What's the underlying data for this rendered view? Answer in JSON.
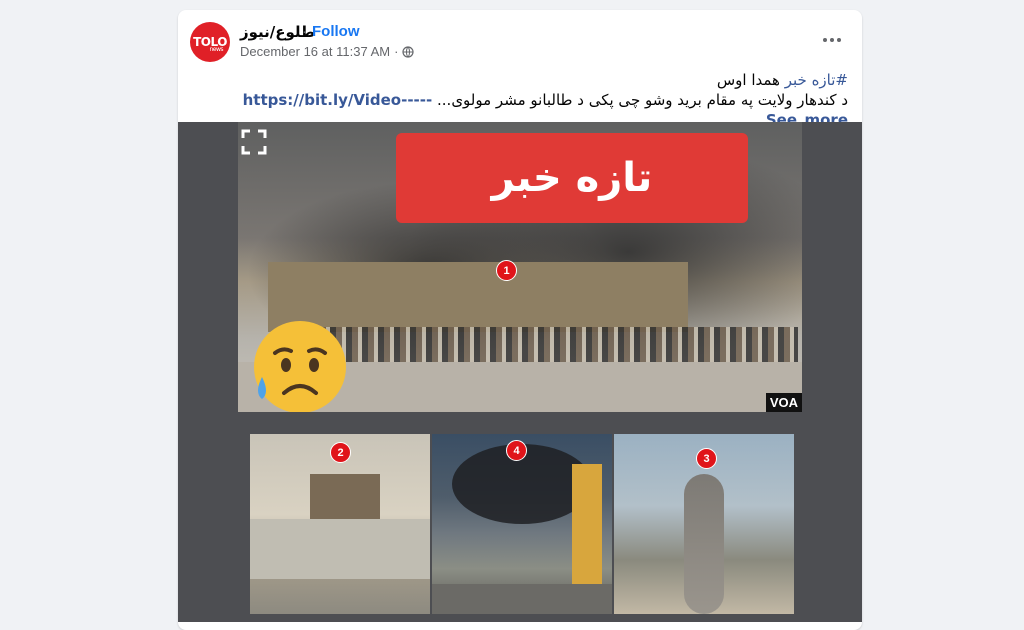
{
  "post": {
    "page_name": "طلوع/نیوز",
    "separator": "·",
    "follow_label": "Follow",
    "timestamp": "December 16 at 11:37 AM",
    "avatar_text": "TOLO",
    "avatar_subtext": "news",
    "hashtag": "#تازه خبر",
    "text_line1_rest": "همدا اوس",
    "text_line2": "د کندهار ولایت په مقام برید وشو چی پکی د طالبانو مشر مولوی...",
    "link": "https://bit.ly/Video-----See_more"
  },
  "media": {
    "banner_text": "تازه خبر",
    "watermark": "VOA",
    "markers": [
      "1",
      "2",
      "4",
      "3"
    ],
    "emoji": "sad-but-relieved-face"
  },
  "colors": {
    "brand_red": "#e02027",
    "link_blue": "#1877f2",
    "banner_red": "#e03a36",
    "marker_red": "#e0141a"
  }
}
